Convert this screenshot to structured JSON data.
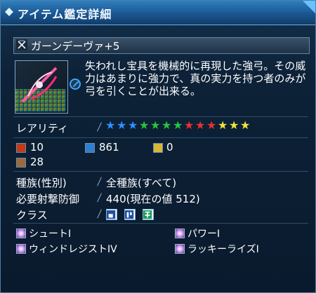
{
  "window": {
    "title": "アイテム鑑定詳細"
  },
  "item": {
    "name": "ガーンデーヴァ+5",
    "description": "失われし宝具を機械的に再現した強弓。その威力はあまりに強力で、真の実力を持つ者のみが弓を引くことが出来る。",
    "icon": "bow-weapon-icon"
  },
  "rarity": {
    "label": "レアリティ",
    "count": 13,
    "colors": [
      "#2f8fff",
      "#2f8fff",
      "#2f8fff",
      "#28c43c",
      "#28c43c",
      "#28c43c",
      "#28c43c",
      "#e63232",
      "#e63232",
      "#e63232",
      "#f2e33a",
      "#f2e33a",
      "#f2e33a"
    ]
  },
  "stats": {
    "attack1": "10",
    "attack2": "861",
    "attack3": "0",
    "element": "28"
  },
  "info": {
    "race_label": "種族(性別)",
    "race_value": "全種族(すべて)",
    "req_label": "必要射撃防御",
    "req_value": "440(現在の値 512)",
    "class_label": "クラス",
    "class_icons": [
      "class-ranger-icon",
      "class-gunner-icon",
      "class-braver-icon"
    ]
  },
  "abilities": [
    "シュートI",
    "パワーI",
    "ウィンドレジストIV",
    "ラッキーライズI"
  ]
}
